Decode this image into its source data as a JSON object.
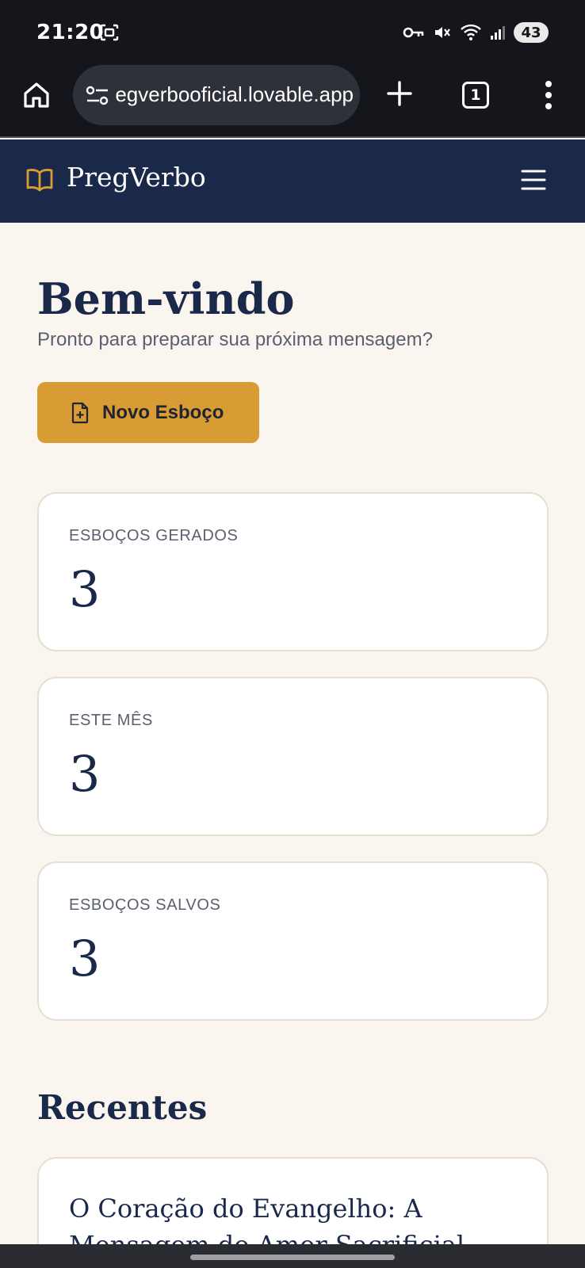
{
  "status_bar": {
    "time": "21:20",
    "battery": "43",
    "icons": [
      "screenshot-icon",
      "vpn-key-icon",
      "mute-icon",
      "wifi-icon",
      "signal-icon"
    ]
  },
  "browser": {
    "url": "pregverbooficial.lovable.app",
    "tab_count": "1",
    "icons": [
      "home-icon",
      "site-settings-icon",
      "new-tab-icon",
      "tabs-icon",
      "more-menu-icon"
    ]
  },
  "app": {
    "name": "PregVerbo",
    "logo_icon": "book-open-icon",
    "menu_icon": "hamburger-menu-icon"
  },
  "welcome": {
    "title": "Bem-vindo",
    "subtitle": "Pronto para preparar sua próxima mensagem?"
  },
  "new_outline_button": {
    "label": "Novo Esboço",
    "icon": "file-plus-icon"
  },
  "stats": [
    {
      "label": "ESBOÇOS GERADOS",
      "value": "3"
    },
    {
      "label": "ESTE MÊS",
      "value": "3"
    },
    {
      "label": "ESBOÇOS SALVOS",
      "value": "3"
    }
  ],
  "recent": {
    "title": "Recentes",
    "items": [
      {
        "title": "O Coração do Evangelho: A Mensagem do Amor Sacrificial"
      }
    ]
  },
  "colors": {
    "header_bg": "#1a2849",
    "accent": "#d99b33",
    "page_bg": "#faf6ef",
    "heading": "#1a2849"
  }
}
